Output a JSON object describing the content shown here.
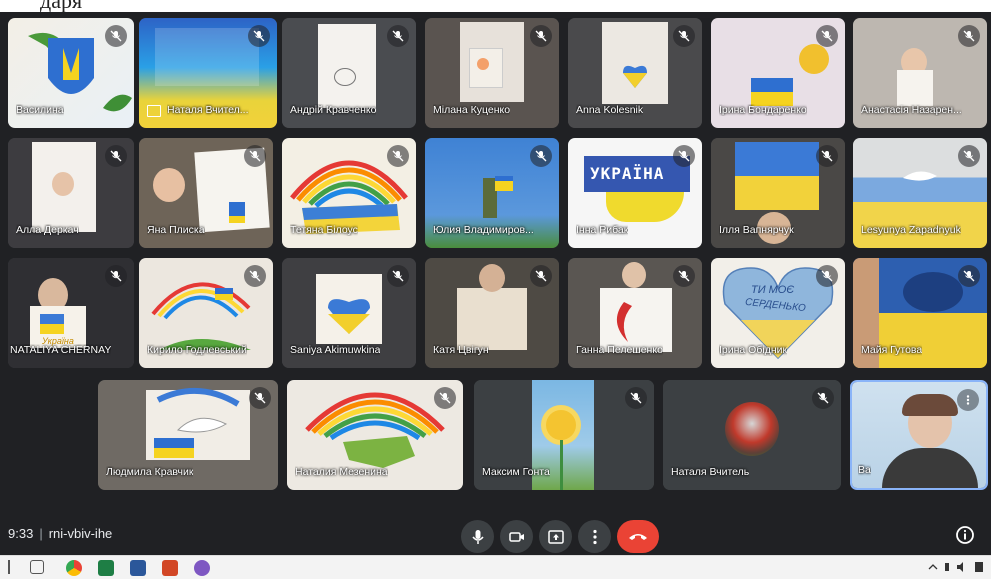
{
  "header_fragment": "даря",
  "participants": [
    {
      "name": "Василина"
    },
    {
      "name": "Наталя Вчител..."
    },
    {
      "name": "Андрій Кравченко"
    },
    {
      "name": "Мілана Куценко"
    },
    {
      "name": "Anna Kolesnik"
    },
    {
      "name": "Ірина Бондаренко"
    },
    {
      "name": "Анастасія Назарен..."
    },
    {
      "name": "Алла Деркач"
    },
    {
      "name": "Яна Плиска"
    },
    {
      "name": "Тетяна Білоус"
    },
    {
      "name": "Юлия Владимиров..."
    },
    {
      "name": "Інна Рибак"
    },
    {
      "name": "Ілля Вапнярчук"
    },
    {
      "name": "Lesyunya Zapadnyuk"
    },
    {
      "name": "NATALIYA CHERNAY"
    },
    {
      "name": "Кирило Годлевський"
    },
    {
      "name": "Saniya Akimuwkina"
    },
    {
      "name": "Катя Цвігун"
    },
    {
      "name": "Ганна Пелешенко"
    },
    {
      "name": "Ірина Обідник"
    },
    {
      "name": "Майя Гутова"
    },
    {
      "name": "Людмила Кравчик"
    },
    {
      "name": "Наталия Мезенина"
    },
    {
      "name": "Максим Гонта"
    },
    {
      "name": "Наталя Вчитель"
    },
    {
      "name": "Ва"
    }
  ],
  "drawing_text": {
    "ukraina": "УКРАЇНА",
    "heart_line1": "ТИ МОЄ",
    "heart_line2": "СЕРДЕНЬКО",
    "poster_ukraine": "Україна"
  },
  "meeting": {
    "time": "9:33",
    "code": "rni-vbiv-ihe"
  },
  "colors": {
    "meet_bg": "#202124",
    "tile_bg": "#3c4043",
    "hangup": "#ea4335",
    "ukraine_blue": "#2e6fd0",
    "ukraine_yellow": "#f5d320"
  }
}
